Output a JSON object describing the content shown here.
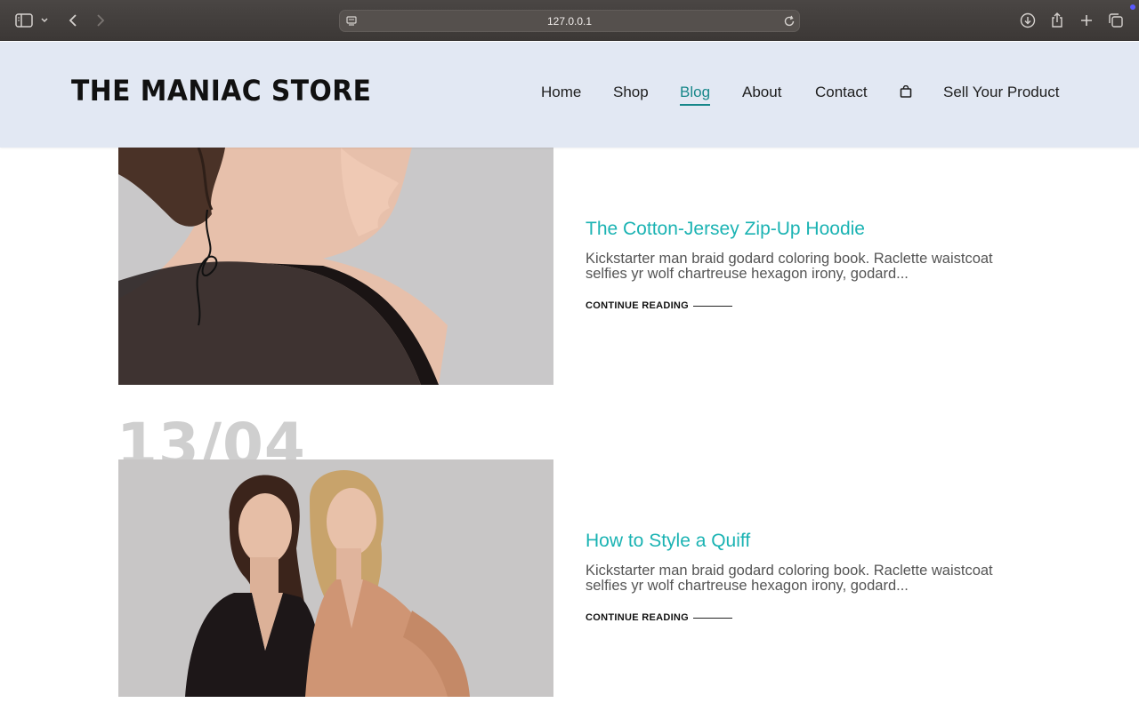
{
  "browser": {
    "url": "127.0.0.1",
    "icons": [
      "sidebar-toggle-icon",
      "chevron-down-icon",
      "back-arrow-icon",
      "forward-arrow-icon",
      "site-settings-icon",
      "reload-icon",
      "download-icon",
      "share-icon",
      "new-tab-plus-icon",
      "tab-overview-icon"
    ]
  },
  "site": {
    "logo": "THE MANIAC STORE",
    "nav": {
      "home": "Home",
      "shop": "Shop",
      "blog": "Blog",
      "about": "About",
      "contact": "Contact",
      "sell": "Sell Your Product"
    },
    "active_nav": "Blog",
    "accent_color": "#17878a",
    "title_color": "#1bb3b3"
  },
  "posts": [
    {
      "title": "The Cotton-Jersey Zip-Up Hoodie",
      "excerpt": "Kickstarter man braid godard coloring book. Raclette waistcoat selfies yr wolf chartreuse hexagon irony, godard...",
      "read_more": "CONTINUE READING"
    },
    {
      "date": "13/04",
      "title": "How to Style a Quiff",
      "excerpt": "Kickstarter man braid godard coloring book. Raclette waistcoat selfies yr wolf chartreuse hexagon irony, godard...",
      "read_more": "CONTINUE READING"
    }
  ]
}
